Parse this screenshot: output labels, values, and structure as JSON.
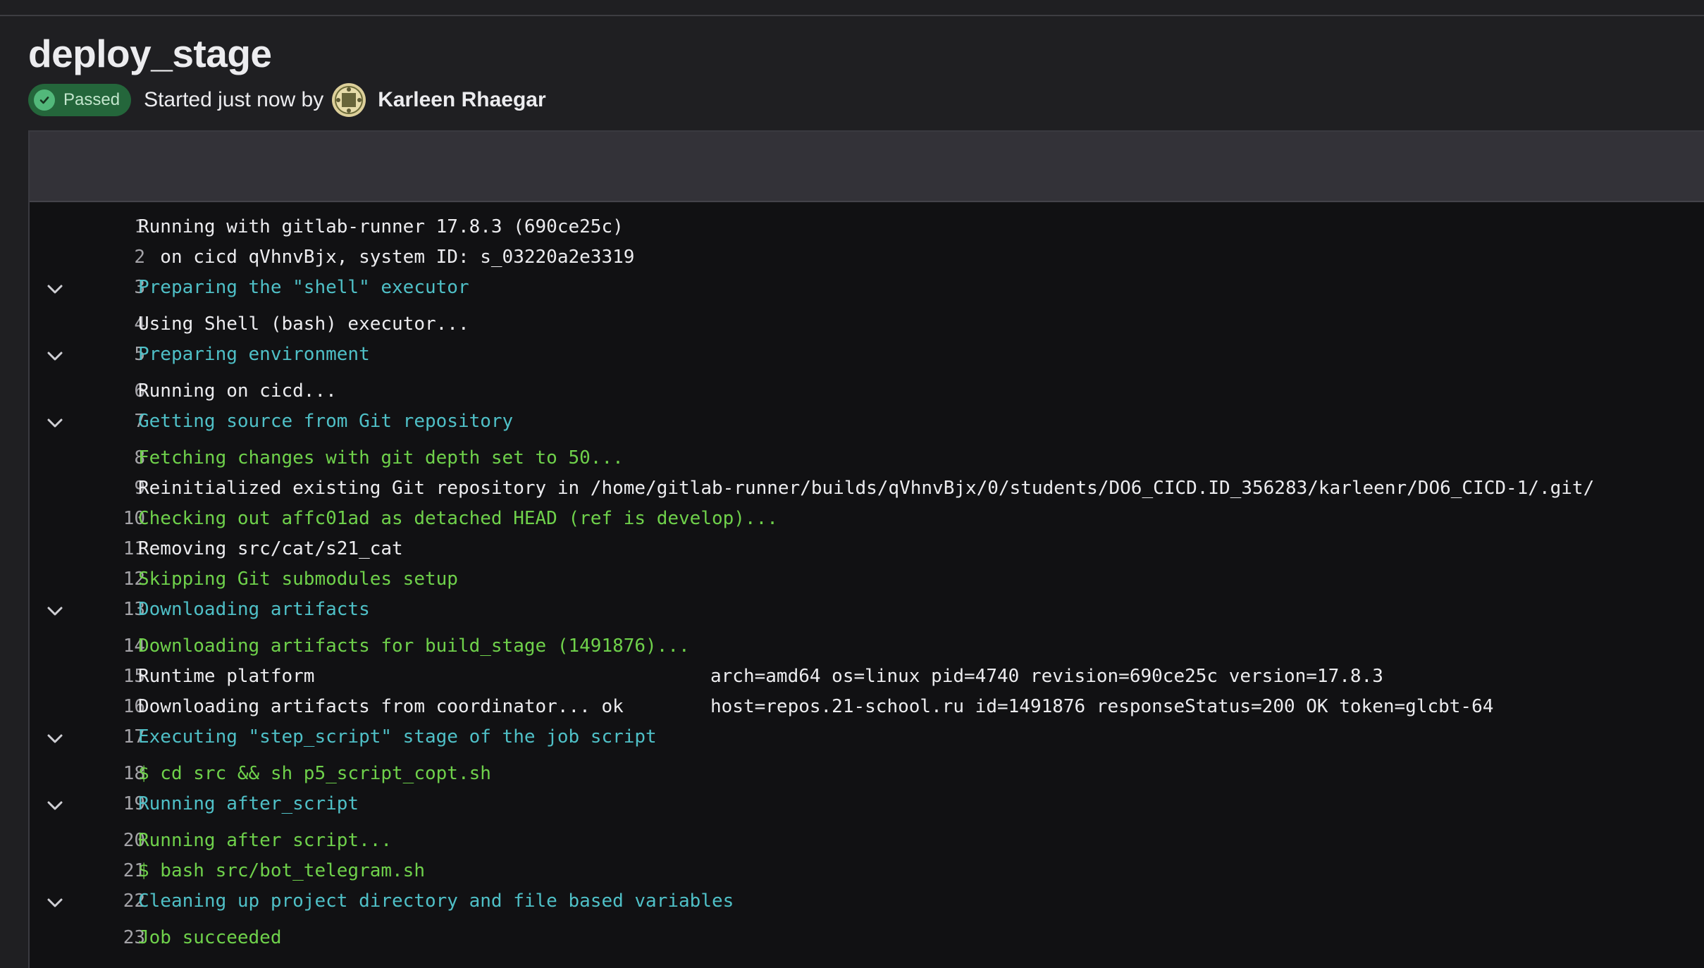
{
  "job": {
    "title": "deploy_stage",
    "status": "Passed",
    "started_text": "Started just now by",
    "author": "Karleen Rhaegar"
  },
  "colors": {
    "section_header": "#4fc0c7",
    "success_text": "#6fd14b",
    "normal_text": "#ececef",
    "badge_bg": "#24663b"
  },
  "icons": {
    "status": "check-circle-icon",
    "collapse": "chevron-down-icon",
    "avatar": "user-avatar"
  },
  "log": {
    "lines": [
      {
        "n": "1",
        "text": "Running with gitlab-runner 17.8.3 (690ce25c)",
        "style": "normal"
      },
      {
        "n": "2",
        "text": "  on cicd qVhnvBjx, system ID: s_03220a2e3319",
        "style": "normal"
      },
      {
        "n": "3",
        "text": "Preparing the \"shell\" executor",
        "style": "section",
        "collapsible": true
      },
      {
        "n": "4",
        "text": "Using Shell (bash) executor...",
        "style": "normal"
      },
      {
        "n": "5",
        "text": "Preparing environment",
        "style": "section",
        "collapsible": true
      },
      {
        "n": "6",
        "text": "Running on cicd...",
        "style": "normal"
      },
      {
        "n": "7",
        "text": "Getting source from Git repository",
        "style": "section",
        "collapsible": true
      },
      {
        "n": "8",
        "text": "Fetching changes with git depth set to 50...",
        "style": "success"
      },
      {
        "n": "9",
        "text": "Reinitialized existing Git repository in /home/gitlab-runner/builds/qVhnvBjx/0/students/DO6_CICD.ID_356283/karleenr/DO6_CICD-1/.git/",
        "style": "normal"
      },
      {
        "n": "10",
        "text": "Checking out affc01ad as detached HEAD (ref is develop)...",
        "style": "success"
      },
      {
        "n": "11",
        "text": "Removing src/cat/s21_cat",
        "style": "normal"
      },
      {
        "n": "12",
        "text": "Skipping Git submodules setup",
        "style": "success"
      },
      {
        "n": "13",
        "text": "Downloading artifacts",
        "style": "section",
        "collapsible": true
      },
      {
        "n": "14",
        "text": "Downloading artifacts for build_stage (1491876)...",
        "style": "success"
      },
      {
        "n": "15",
        "text": "Runtime platform",
        "text2": "arch=amd64 os=linux pid=4740 revision=690ce25c version=17.8.3",
        "style": "normal"
      },
      {
        "n": "16",
        "text": "Downloading artifacts from coordinator... ok",
        "text2": "host=repos.21-school.ru id=1491876 responseStatus=200 OK token=glcbt-64",
        "style": "normal"
      },
      {
        "n": "17",
        "text": "Executing \"step_script\" stage of the job script",
        "style": "section",
        "collapsible": true
      },
      {
        "n": "18",
        "text": "$ cd src && sh p5_script_copt.sh",
        "style": "success"
      },
      {
        "n": "19",
        "text": "Running after_script",
        "style": "section",
        "collapsible": true
      },
      {
        "n": "20",
        "text": "Running after script...",
        "style": "success"
      },
      {
        "n": "21",
        "text": "$ bash src/bot_telegram.sh",
        "style": "success"
      },
      {
        "n": "22",
        "text": "Cleaning up project directory and file based variables",
        "style": "section",
        "collapsible": true
      },
      {
        "n": "23",
        "text": "Job succeeded",
        "style": "success"
      }
    ]
  }
}
